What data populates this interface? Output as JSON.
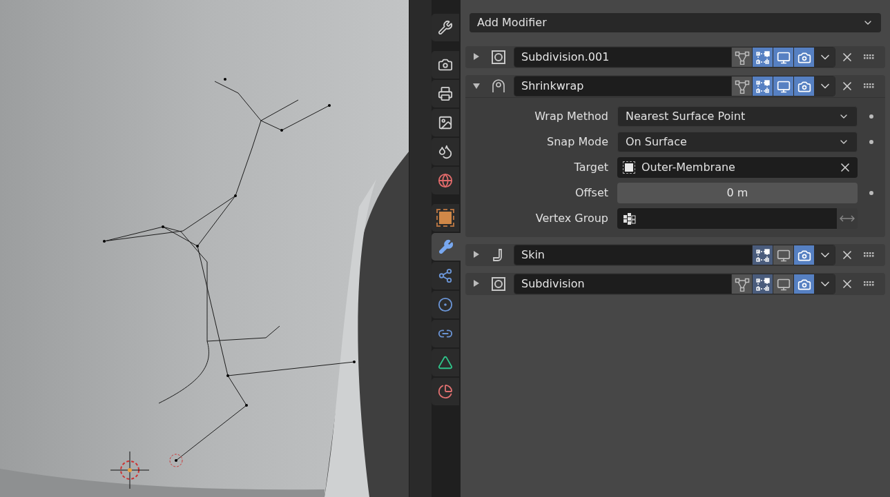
{
  "tabs": [
    {
      "kind": "tool",
      "selected": false
    },
    {
      "kind": "render",
      "selected": false
    },
    {
      "kind": "output",
      "selected": false
    },
    {
      "kind": "view_layer",
      "selected": false
    },
    {
      "kind": "scene",
      "selected": false
    },
    {
      "kind": "world",
      "selected": false
    },
    {
      "kind": "object",
      "selected": false
    },
    {
      "kind": "modifier",
      "selected": true
    },
    {
      "kind": "particles",
      "selected": false
    },
    {
      "kind": "physics",
      "selected": false
    },
    {
      "kind": "constraints",
      "selected": false
    },
    {
      "kind": "data",
      "selected": false
    },
    {
      "kind": "material",
      "selected": false
    }
  ],
  "add_modifier": {
    "label": "Add Modifier"
  },
  "modifiers": [
    {
      "name": "Subdivision.001",
      "kind": "subdivision",
      "expanded": false,
      "on_cage": false,
      "edit_mode": true,
      "viewport": true,
      "render": true
    },
    {
      "name": "Shrinkwrap",
      "kind": "shrinkwrap",
      "expanded": true,
      "on_cage": false,
      "edit_mode": true,
      "viewport": true,
      "render": true,
      "fields": [
        {
          "kind": "dropdown",
          "label": "Wrap Method",
          "value": "Nearest Surface Point"
        },
        {
          "kind": "dropdown",
          "label": "Snap Mode",
          "value": "On Surface"
        },
        {
          "kind": "object",
          "label": "Target",
          "value": "Outer-Membrane"
        },
        {
          "kind": "number",
          "label": "Offset",
          "value": "0 m"
        },
        {
          "kind": "vertex_group",
          "label": "Vertex Group"
        }
      ]
    },
    {
      "name": "Skin",
      "kind": "skin",
      "expanded": false,
      "edit_mode": true,
      "viewport": false,
      "render": true
    },
    {
      "name": "Subdivision",
      "kind": "subdivision",
      "expanded": false,
      "on_cage": false,
      "edit_mode": true,
      "viewport": false,
      "render": true
    }
  ]
}
